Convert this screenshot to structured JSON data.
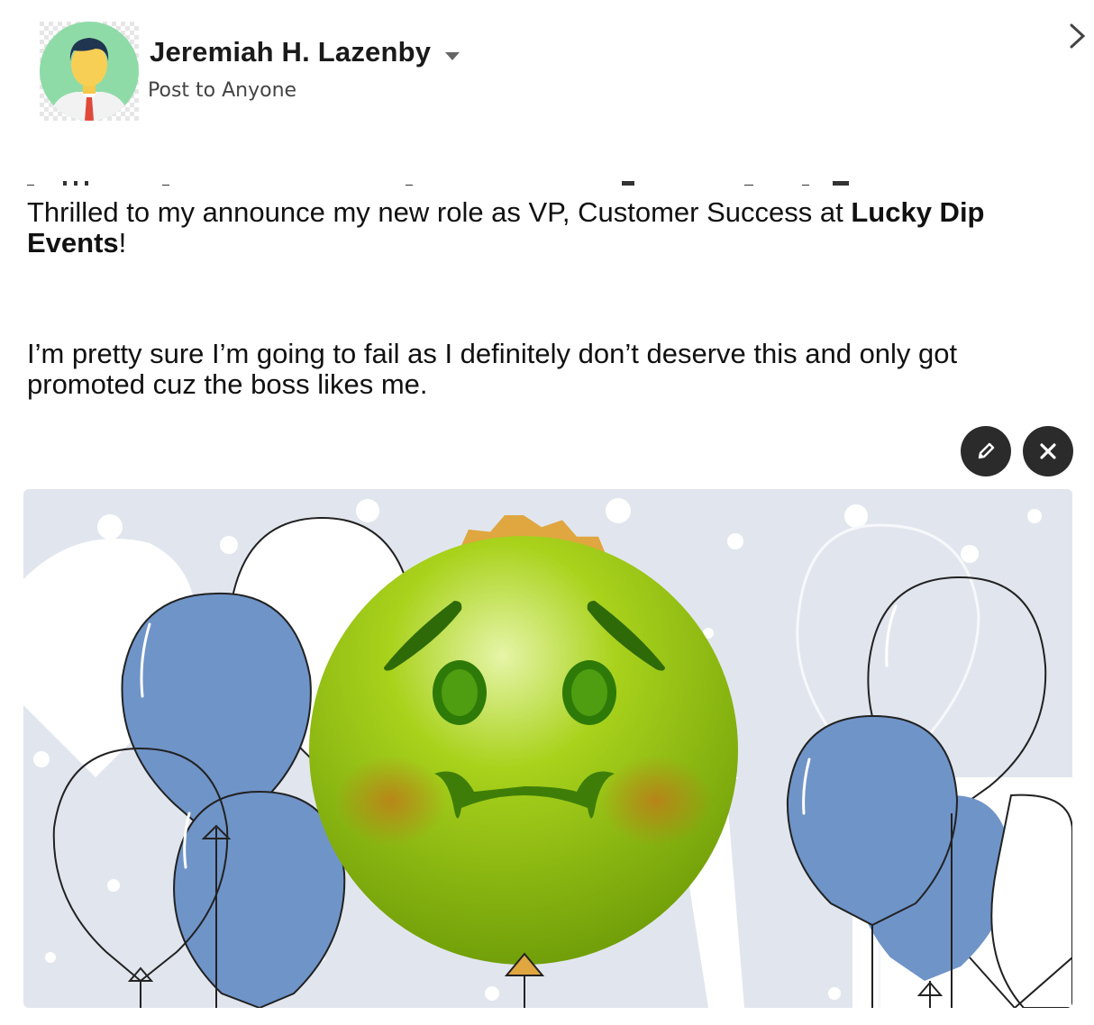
{
  "author": {
    "name": "Jeremiah H. Lazenby",
    "audience": "Post to Anyone",
    "avatar_icon": "person-avatar-icon"
  },
  "post": {
    "paragraph1_prefix": "Thrilled to my announce my new role as VP, Customer Success at ",
    "company": "Lucky Dip Events",
    "paragraph1_suffix": "!",
    "paragraph2": "I’m pretty sure I’m going to fail as I definitely don’t deserve this and only got promoted cuz the boss likes me."
  },
  "image_actions": {
    "edit_icon": "pencil-icon",
    "remove_icon": "close-icon"
  },
  "navigation": {
    "next_icon": "chevron-right-icon"
  },
  "image": {
    "emoji": "nauseated-face",
    "background": "balloons",
    "colors": {
      "sky": "#e1e6ee",
      "balloon_blue": "#6f94c8",
      "emoji_green": "#8cbc10",
      "badge_orange": "#e0a640"
    }
  }
}
